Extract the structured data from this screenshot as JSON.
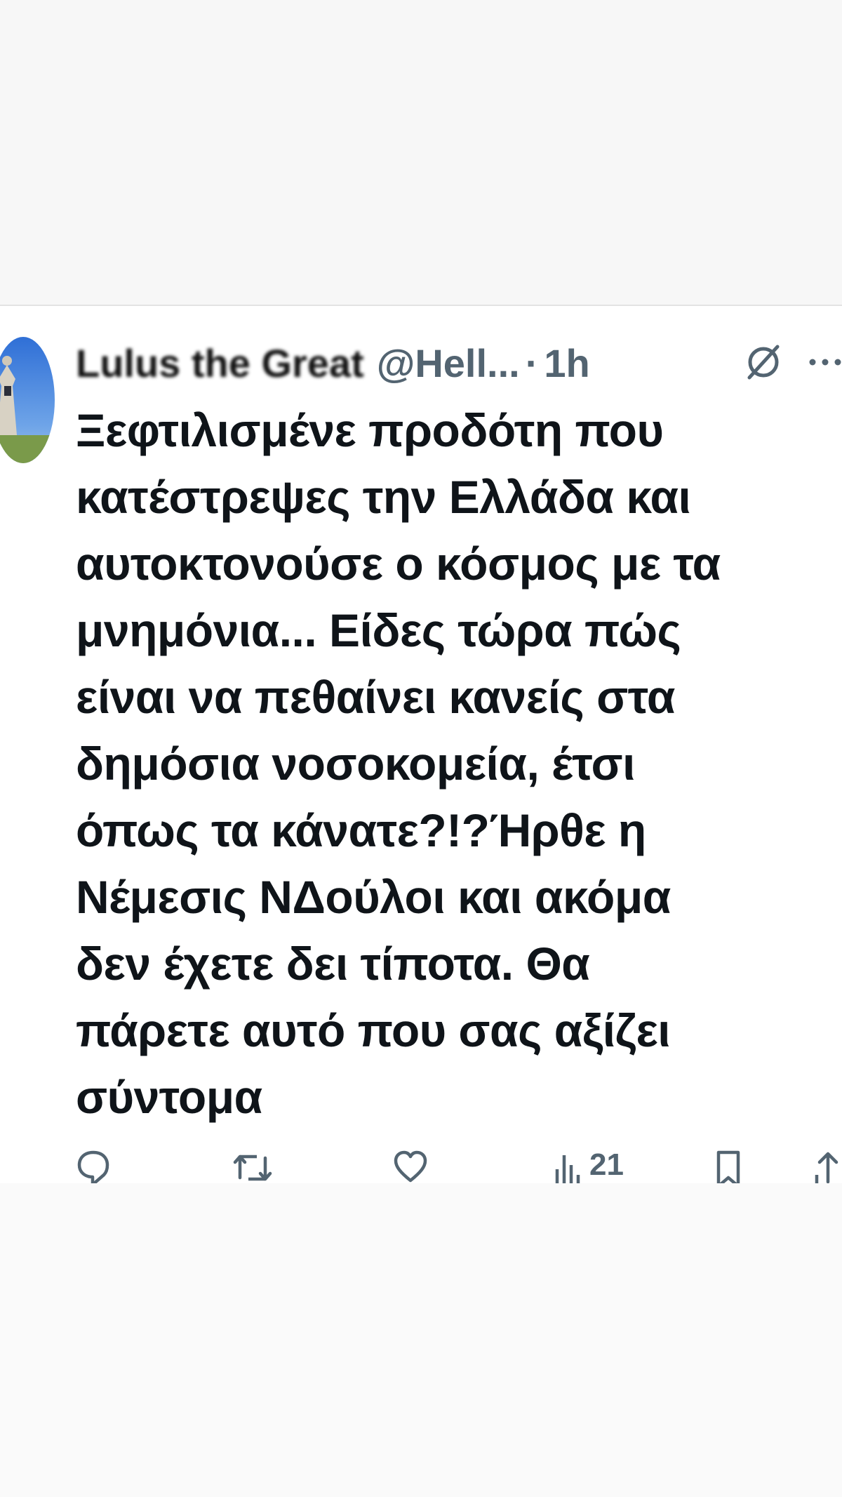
{
  "tweet": {
    "display_name": "Lulus the Great",
    "handle": "@Hell...",
    "separator": "·",
    "time": "1h",
    "text": "Ξεφτιλισμένε προδότη που\nκατέστρεψες την Ελλάδα και\nαυτοκτονούσε ο κόσμος με τα\nμνημόνια... Είδες τώρα πώς\nείναι να πεθαίνει κανείς στα\nδημόσια νοσοκομεία, έτσι\nόπως τα κάνατε?!?Ήρθε η\nΝέμεσις ΝΔούλοι και ακόμα\nδεν έχετε δει τίποτα. Θα\nπάρετε αυτό που σας αξίζει\nσύντομα",
    "views": "21"
  },
  "icons": {
    "avatar": "avatar-statue-image",
    "grok": "grok-icon",
    "more": "more-dots-icon",
    "reply": "reply-icon",
    "retweet": "retweet-icon",
    "like": "heart-icon",
    "views": "views-chart-icon",
    "bookmark": "bookmark-icon",
    "share": "share-icon"
  },
  "colors": {
    "text": "#0f1419",
    "secondary": "#536471",
    "background": "#ffffff"
  }
}
